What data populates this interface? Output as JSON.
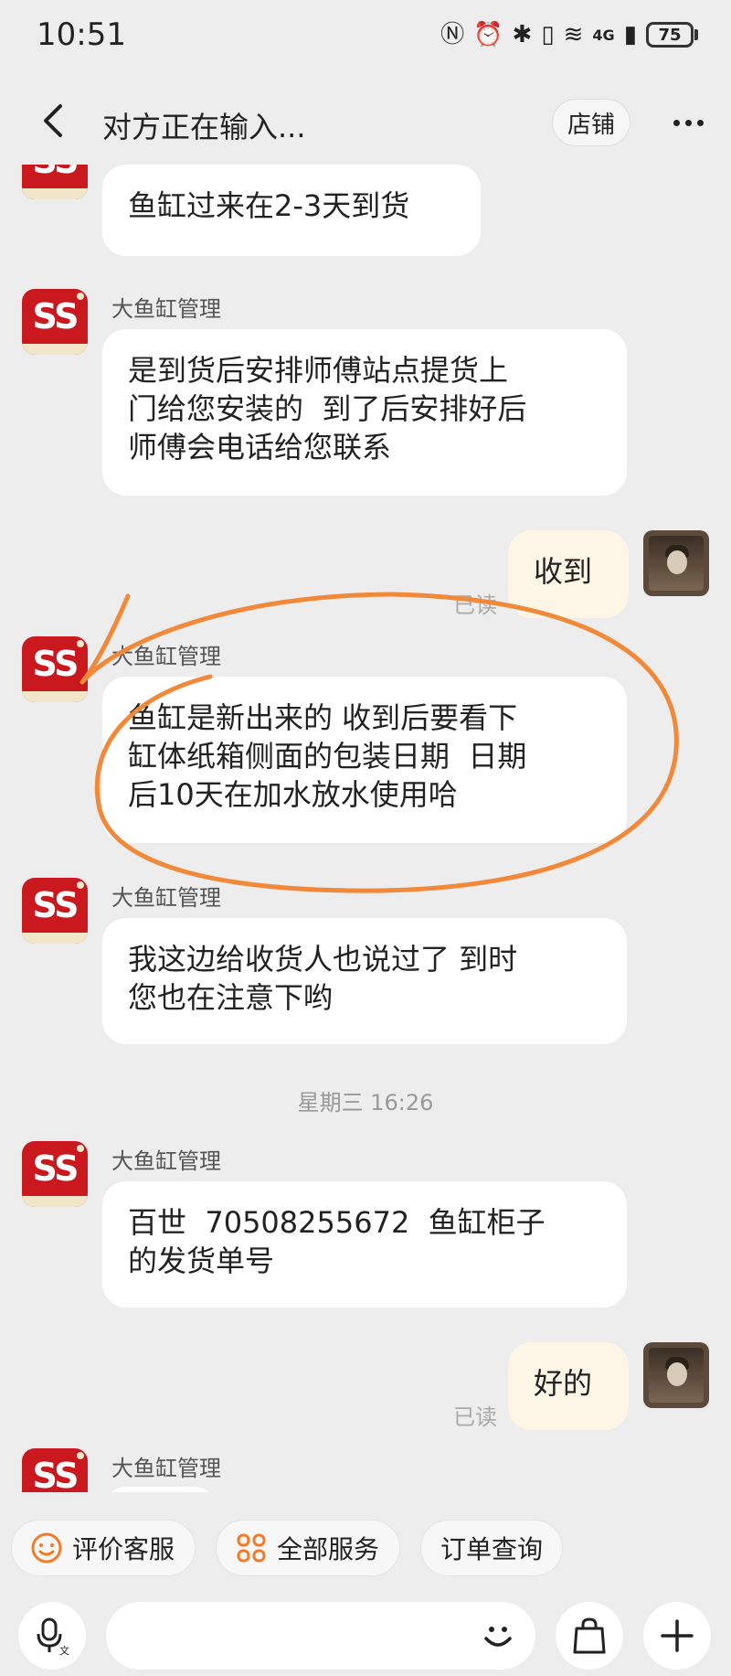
{
  "status_bar": {
    "time": "10:51",
    "network": "4G",
    "battery": "75"
  },
  "header": {
    "title": "对方正在输入...",
    "store_label": "店铺"
  },
  "chat": {
    "messages": [
      {
        "text": "鱼缸过来在2-3天到货"
      },
      {
        "sender": "大鱼缸管理",
        "text": "是到货后安排师傅站点提货上\n门给您安装的  到了后安排好后\n师傅会电话给您联系"
      },
      {
        "text": "收到",
        "read": "已读"
      },
      {
        "sender": "大鱼缸管理",
        "text": "鱼缸是新出来的 收到后要看下\n缸体纸箱侧面的包装日期  日期\n后10天在加水放水使用哈"
      },
      {
        "sender": "大鱼缸管理",
        "text": "我这边给收货人也说过了 到时\n您也在注意下哟"
      },
      {
        "timestamp": "星期三 16:26"
      },
      {
        "sender": "大鱼缸管理",
        "text": "百世  70508255672  鱼缸柜子\n的发货单号"
      },
      {
        "text": "好的",
        "read": "已读"
      },
      {
        "sender": "大鱼缸管理"
      }
    ],
    "annotation_color": "#f0893a"
  },
  "quick_actions": [
    {
      "label": "评价客服",
      "icon": "smile-icon"
    },
    {
      "label": "全部服务",
      "icon": "grid-icon"
    },
    {
      "label": "订单查询"
    }
  ],
  "input": {
    "placeholder": ""
  }
}
